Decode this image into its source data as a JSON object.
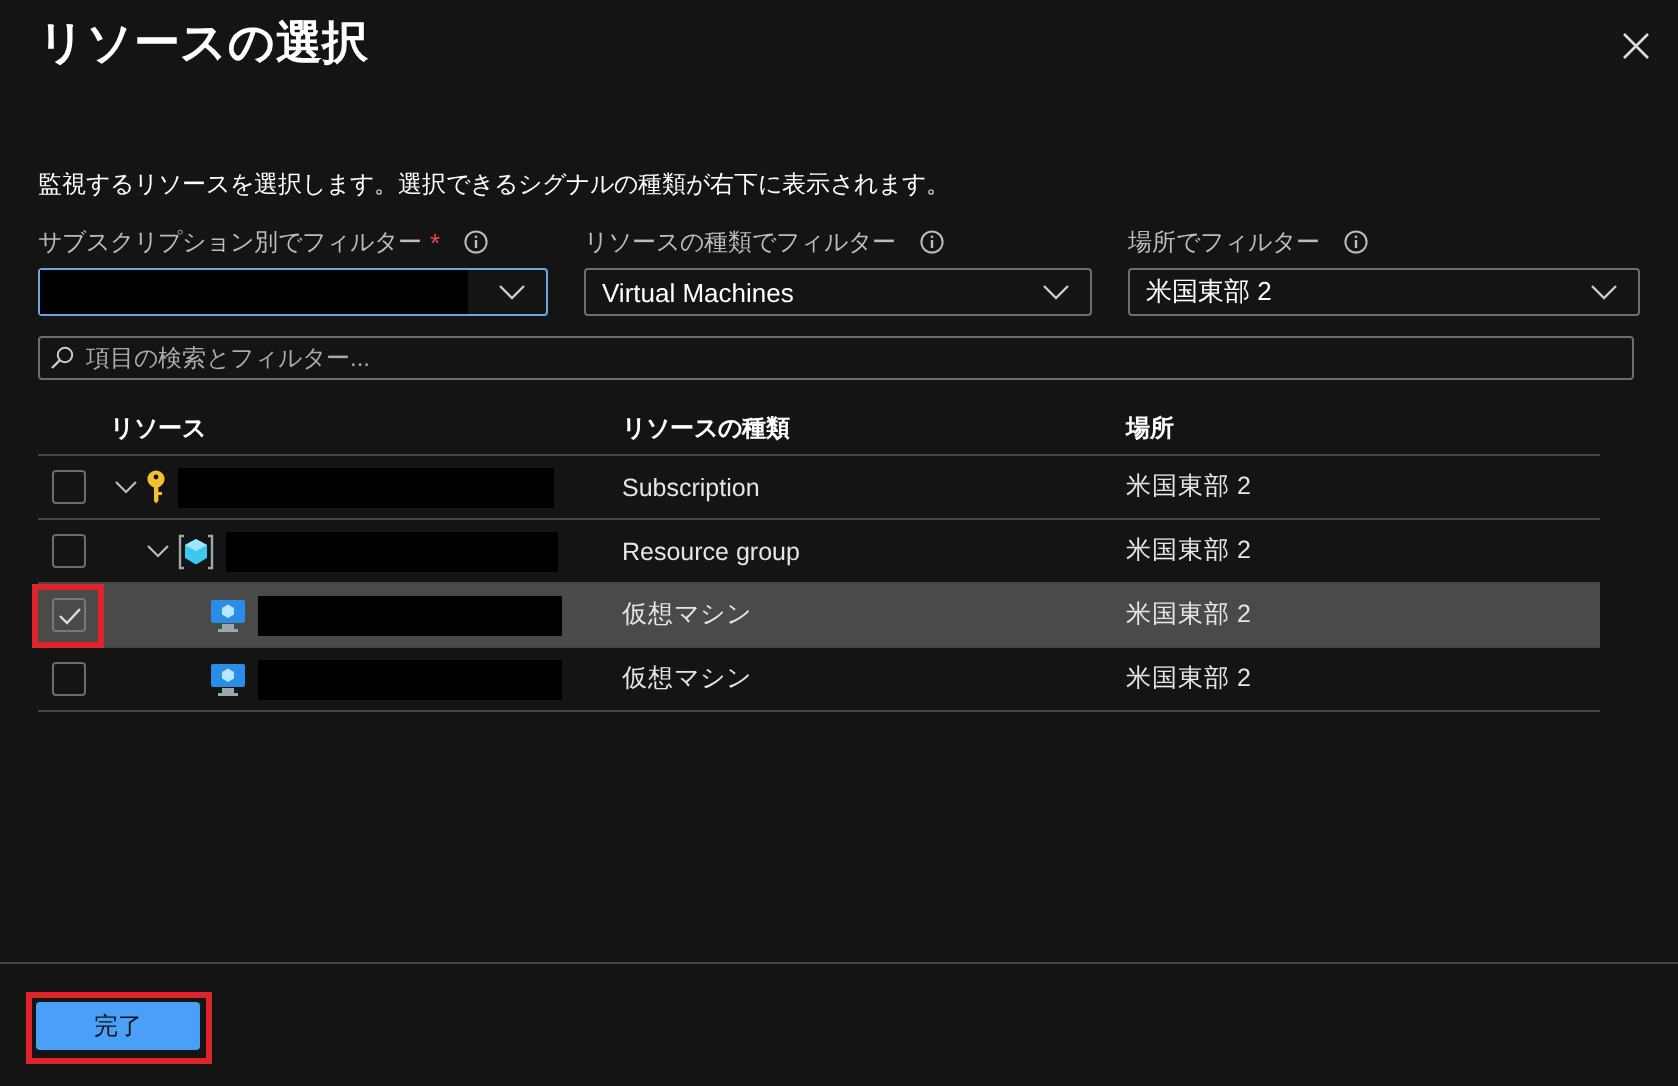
{
  "title": "リソースの選択",
  "description": "監視するリソースを選択します。選択できるシグナルの種類が右下に表示されます。",
  "filters": [
    {
      "label": "サブスクリプション別でフィルター",
      "required_mark": "*",
      "kind": "redacted",
      "focused": true
    },
    {
      "label": "リソースの種類でフィルター",
      "kind": "text",
      "value": "Virtual Machines",
      "focused": false
    },
    {
      "label": "場所でフィルター",
      "kind": "text",
      "value": "米国東部 2",
      "focused": false
    }
  ],
  "search": {
    "placeholder": "項目の検索とフィルター..."
  },
  "columns": [
    "リソース",
    "リソースの種類",
    "場所"
  ],
  "rows": [
    {
      "kind": "subscription",
      "type": "Subscription",
      "location": "米国東部 2",
      "checked": false,
      "selected": false,
      "expanded": true,
      "children": [
        {
          "kind": "resource_group",
          "type": "Resource group",
          "location": "米国東部 2",
          "checked": false,
          "selected": false,
          "expanded": true,
          "children": [
            {
              "kind": "vm",
              "type": "仮想マシン",
              "location": "米国東部 2",
              "checked": true,
              "selected": true,
              "highlighted": true
            },
            {
              "kind": "vm",
              "type": "仮想マシン",
              "location": "米国東部 2",
              "checked": false,
              "selected": false,
              "highlighted": false
            }
          ]
        }
      ]
    }
  ],
  "done_button": {
    "label": "完了",
    "highlighted": true
  }
}
